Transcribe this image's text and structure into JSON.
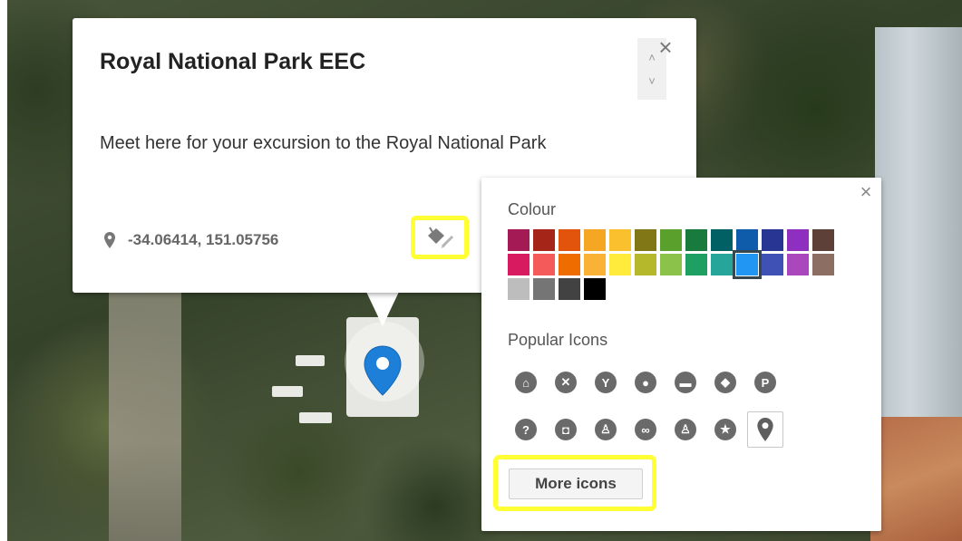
{
  "info_window": {
    "title": "Royal National Park EEC",
    "description": "Meet here for your excursion to the Royal National Park",
    "coordinates": "-34.06414, 151.05756",
    "close_glyph": "×",
    "scroll_up_glyph": "˄",
    "scroll_down_glyph": "˅",
    "pin_icon": "map-pin-icon",
    "style_button_icon": "paint-bucket-icon"
  },
  "style_panel": {
    "close_glyph": "×",
    "colour_label": "Colour",
    "colours": [
      "#a31a55",
      "#a52619",
      "#e2540c",
      "#f5a623",
      "#fbc02d",
      "#827717",
      "#5aa02c",
      "#197a3e",
      "#006064",
      "#0e5caa",
      "#283593",
      "#8e2fbf",
      "#5d4037",
      "#d81b60",
      "#f45a5a",
      "#ef6c00",
      "#f9b233",
      "#ffeb3b",
      "#b5b82a",
      "#8bc34a",
      "#1da061",
      "#26a69a",
      "#2196f3",
      "#3f51b5",
      "#ab47bc",
      "#8d6e63",
      "#bdbdbd",
      "#757575",
      "#424242",
      "#000000"
    ],
    "selected_colour_index": 22,
    "popular_icons_label": "Popular Icons",
    "icons": [
      {
        "name": "home-icon",
        "glyph": "⌂"
      },
      {
        "name": "restaurant-icon",
        "glyph": "✕"
      },
      {
        "name": "bar-icon",
        "glyph": "Y"
      },
      {
        "name": "cafe-icon",
        "glyph": "●"
      },
      {
        "name": "hotel-icon",
        "glyph": "▬"
      },
      {
        "name": "shopping-icon",
        "glyph": "◆"
      },
      {
        "name": "parking-icon",
        "glyph": "P"
      },
      {
        "name": "help-icon",
        "glyph": "?"
      },
      {
        "name": "camera-icon",
        "glyph": "◘"
      },
      {
        "name": "hiking-icon",
        "glyph": "♙"
      },
      {
        "name": "bicycle-icon",
        "glyph": "∞"
      },
      {
        "name": "running-icon",
        "glyph": "♙"
      },
      {
        "name": "star-icon",
        "glyph": "★"
      },
      {
        "name": "map-pin-icon",
        "glyph": ""
      }
    ],
    "selected_icon_index": 13,
    "more_icons_label": "More icons"
  },
  "marker": {
    "color": "#1e7fd8",
    "icon": "map-pin-icon"
  },
  "highlight_color": "#ffff33"
}
